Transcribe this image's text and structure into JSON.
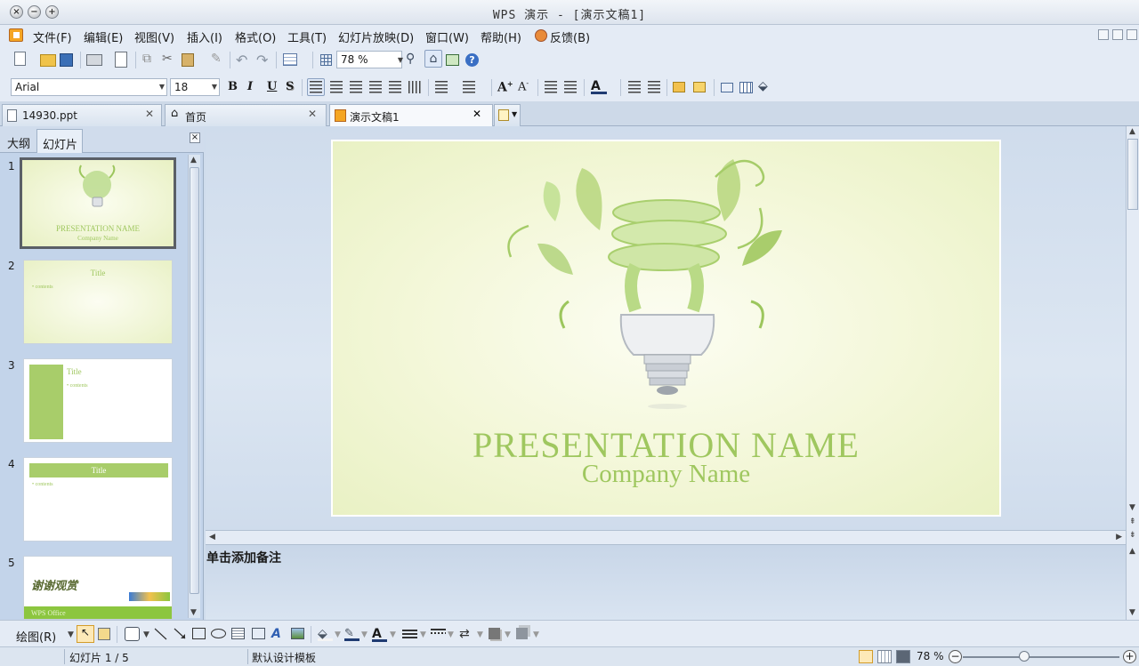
{
  "window": {
    "title": "WPS 演示 - [演示文稿1]"
  },
  "menu": {
    "items": [
      "文件(F)",
      "编辑(E)",
      "视图(V)",
      "插入(I)",
      "格式(O)",
      "工具(T)",
      "幻灯片放映(D)",
      "窗口(W)",
      "帮助(H)"
    ],
    "feedback": "反馈(B)"
  },
  "toolbar": {
    "zoom_value": "78 %",
    "font_name": "Arial",
    "font_size": "18",
    "bold": "B",
    "italic": "I",
    "underline": "U",
    "shadow": "S"
  },
  "tabs": [
    {
      "label": "14930.ppt"
    },
    {
      "label": "首页"
    },
    {
      "label": "演示文稿1"
    }
  ],
  "left_panel": {
    "tab_outline": "大纲",
    "tab_slides": "幻灯片",
    "slides": [
      {
        "num": "1",
        "title": "PRESENTATION NAME",
        "sub": "Company Name"
      },
      {
        "num": "2",
        "title": "Title",
        "body": "• contents"
      },
      {
        "num": "3",
        "title": "Title",
        "body": "• contents"
      },
      {
        "num": "4",
        "title": "Title",
        "body": "• contents"
      },
      {
        "num": "5",
        "title": "谢谢观赏",
        "footer": "WPS Office"
      }
    ]
  },
  "slide": {
    "title": "PRESENTATION  NAME",
    "subtitle": "Company Name"
  },
  "notes": {
    "placeholder": "单击添加备注"
  },
  "drawing_toolbar": {
    "label": "绘图(R)"
  },
  "status": {
    "slide_pos": "幻灯片 1 / 5",
    "template": "默认设计模板",
    "zoom": "78 %",
    "zoom_level": 0.39
  },
  "colors": {
    "slide_text": "#9fc75f",
    "accent": "#8cc63f"
  }
}
